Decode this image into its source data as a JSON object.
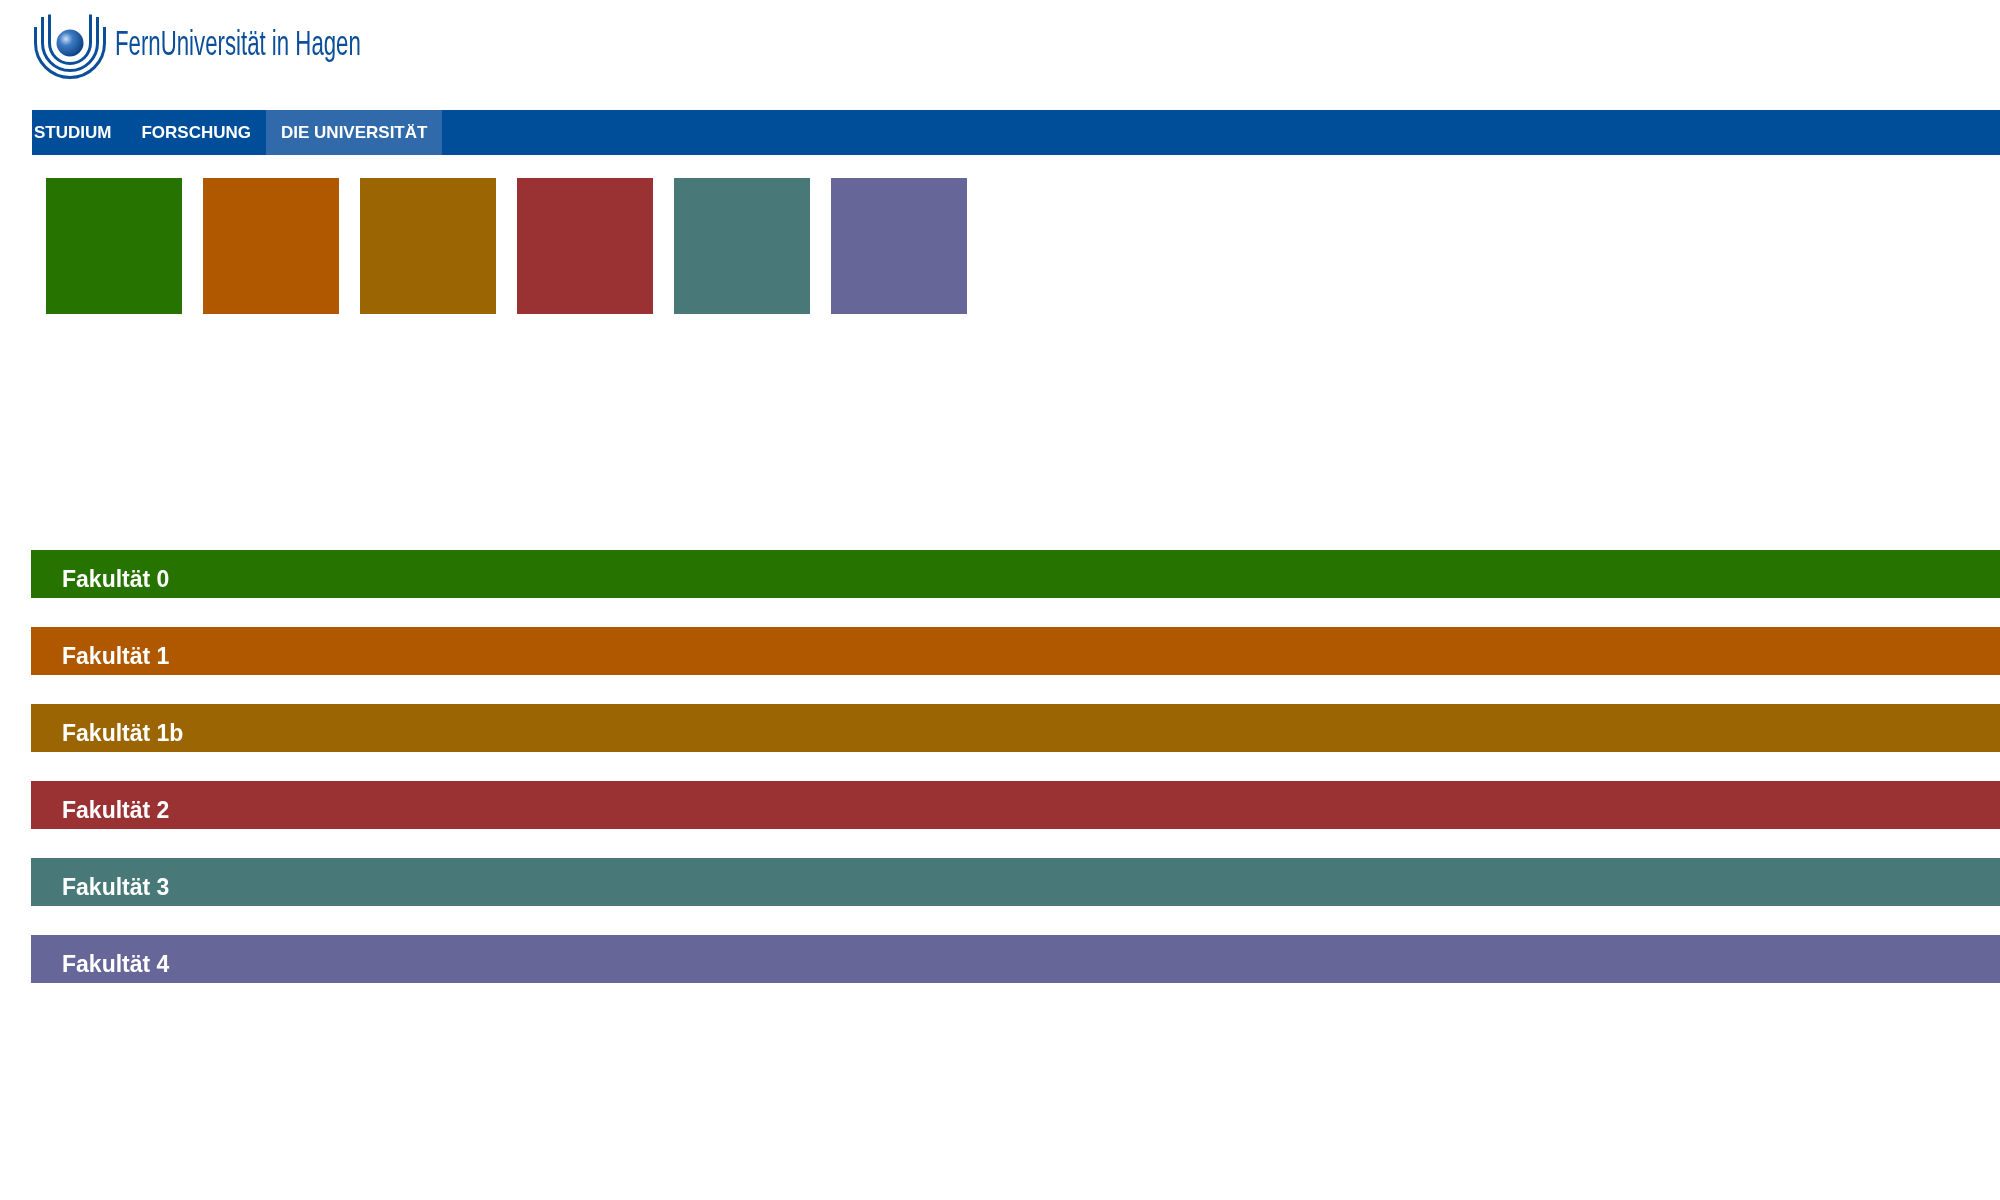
{
  "logo": {
    "text": "FernUniversität in Hagen"
  },
  "nav": {
    "items": [
      {
        "label": "STUDIUM",
        "selected": false
      },
      {
        "label": "FORSCHUNG",
        "selected": false
      },
      {
        "label": "DIE UNIVERSITÄT",
        "selected": true
      }
    ]
  },
  "tiles": [
    {
      "color": "#277300"
    },
    {
      "color": "#b05800"
    },
    {
      "color": "#9a6502"
    },
    {
      "color": "#9a3234"
    },
    {
      "color": "#487878"
    },
    {
      "color": "#666698"
    }
  ],
  "faculties": [
    {
      "label": "Fakultät 0",
      "color": "#277300"
    },
    {
      "label": "Fakultät 1",
      "color": "#b05800"
    },
    {
      "label": "Fakultät 1b",
      "color": "#9a6502"
    },
    {
      "label": "Fakultät 2",
      "color": "#9a3234"
    },
    {
      "label": "Fakultät 3",
      "color": "#487878"
    },
    {
      "label": "Fakultät 4",
      "color": "#666698"
    }
  ]
}
